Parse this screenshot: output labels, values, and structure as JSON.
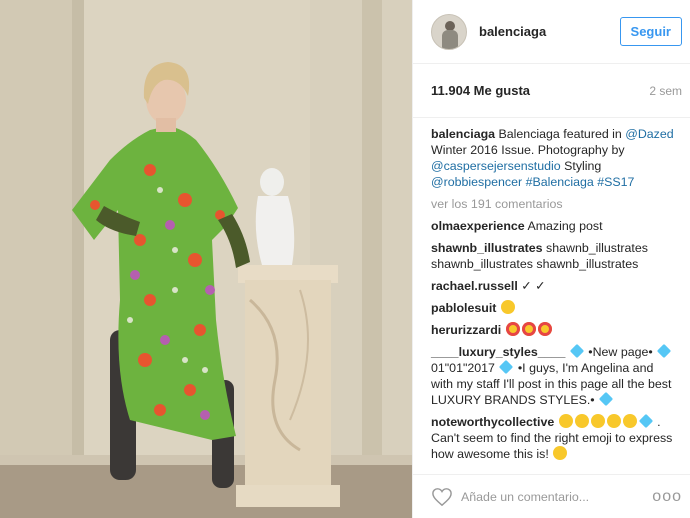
{
  "post": {
    "username": "balenciaga",
    "follow_label": "Seguir",
    "likes": "11.904 Me gusta",
    "time_ago": "2 sem",
    "view_comments": "ver los 191 comentarios",
    "add_comment_placeholder": "Añade un comentario...",
    "options_glyph": "ooo"
  },
  "caption": {
    "user": "balenciaga",
    "t1": "Balenciaga featured in",
    "m1": "@Dazed",
    "t2": "Winter 2016 Issue. Photography by",
    "m2": "@caspersejersenstudio",
    "t3": "Styling",
    "m3": "@robbiespencer",
    "h1": "#Balenciaga",
    "h2": "#SS17"
  },
  "comments": [
    {
      "user": "olmaexperience",
      "text": "Amazing post"
    },
    {
      "user": "shawnb_illustrates",
      "text": "shawnb_illustrates shawnb_illustrates shawnb_illustrates"
    },
    {
      "user": "rachael.russell",
      "text": "✓ ✓"
    },
    {
      "user": "pablolesuit",
      "text": ""
    },
    {
      "user": "herurizzardi",
      "text": ""
    },
    {
      "user": "____luxury_styles____",
      "text": "•New page•",
      "text2": "01\"01\"2017",
      "text3": "•I guys, I'm Angelina and with my staff I'll post in this page all the best LUXURY BRANDS STYLES.•"
    },
    {
      "user": "noteworthycollective",
      "text": ". Can't seem to find the right emoji to express how awesome this is!"
    }
  ],
  "icons": {
    "like": "heart-icon",
    "avatar": "avatar-image",
    "photo": "post-photo"
  }
}
